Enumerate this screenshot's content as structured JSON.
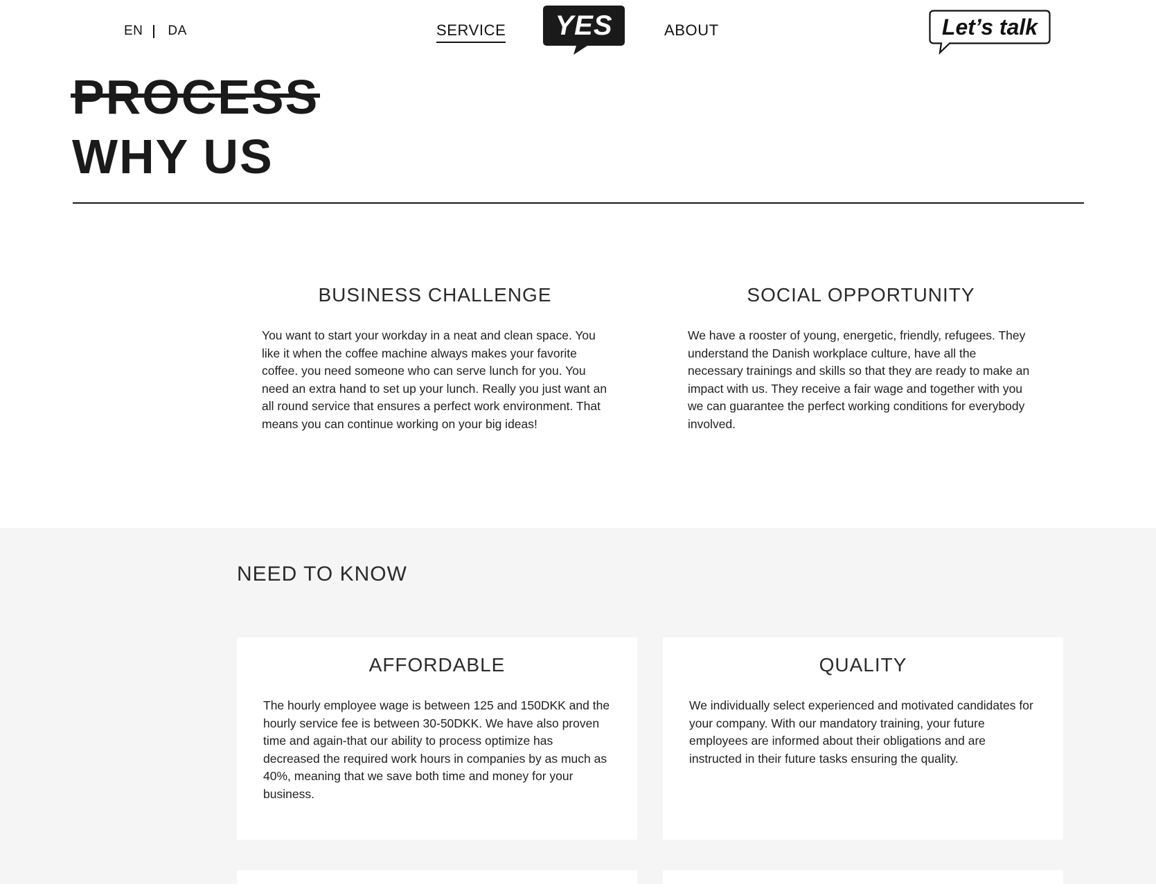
{
  "header": {
    "languages": [
      "EN",
      "DA"
    ],
    "nav": {
      "service": "SERVICE",
      "about": "ABOUT"
    },
    "logo_text": "YES",
    "cta_label": "Let’s talk"
  },
  "hero": {
    "struck_title": "PROCESS",
    "title": "WHY US"
  },
  "intro": {
    "business": {
      "heading": "BUSINESS CHALLENGE",
      "body": "You want to start your workday in a neat and clean space. You like it when the coffee machine always makes your favorite coffee. you need someone who can serve lunch for you. You need an extra hand to set up your lunch. Really you just want an all round service that ensures a perfect work environment. That means you can continue working on your big ideas!"
    },
    "social": {
      "heading": "SOCIAL OPPORTUNITY",
      "body": "We have a rooster of young, energetic, friendly, refugees. They understand the Danish workplace culture, have all the necessary trainings and skills so that they are ready to make an impact with us. They receive a fair wage and together with you we can guarantee the perfect working conditions for everybody involved."
    }
  },
  "need_to_know": {
    "title": "NEED TO KNOW",
    "cards": [
      {
        "heading": "AFFORDABLE",
        "body": "The hourly employee wage is between 125 and 150DKK and the hourly service fee is between 30-50DKK. We have also proven time and again-that our ability to process optimize has decreased the required work hours in companies by as much as 40%, meaning that we save both time and money for your business."
      },
      {
        "heading": "QUALITY",
        "body": "We individually select experienced and motivated candidates for your company. With our mandatory training, your future employees are informed about their obligations and are instructed in their future tasks ensuring the quality."
      }
    ]
  },
  "colors": {
    "text": "#1a1a1a",
    "section_bg": "#f5f5f5",
    "card_bg": "#ffffff",
    "logo_bg": "#1a1a1a"
  },
  "icons": {
    "logo": "speech-bubble-logo",
    "cta": "speech-bubble-outline"
  }
}
